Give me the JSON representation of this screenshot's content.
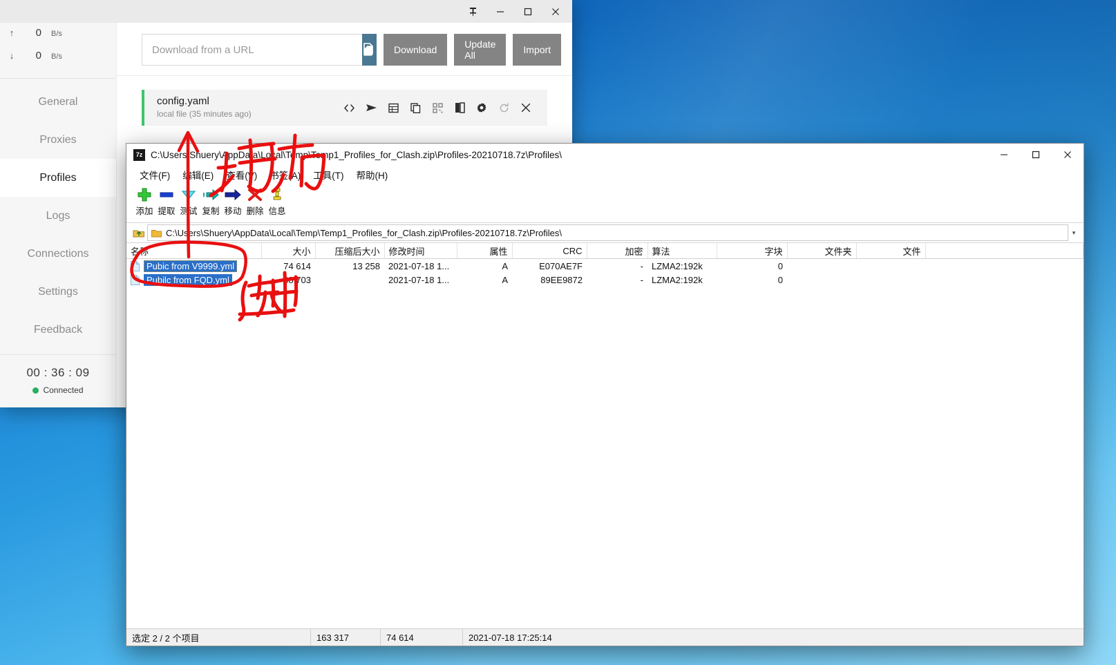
{
  "clash": {
    "titlebar": {
      "pin": "pin-icon",
      "minimize": "–",
      "maximize": "□",
      "close": "✕"
    },
    "speed": {
      "upload": {
        "arrow": "↑",
        "value": "0",
        "unit": "B/s"
      },
      "download": {
        "arrow": "↓",
        "value": "0",
        "unit": "B/s"
      }
    },
    "nav": [
      {
        "label": "General",
        "active": false
      },
      {
        "label": "Proxies",
        "active": false
      },
      {
        "label": "Profiles",
        "active": true
      },
      {
        "label": "Logs",
        "active": false
      },
      {
        "label": "Connections",
        "active": false
      },
      {
        "label": "Settings",
        "active": false
      },
      {
        "label": "Feedback",
        "active": false
      }
    ],
    "footer": {
      "clock": "00 : 36 : 09",
      "status": "Connected",
      "status_color": "#27ae60"
    },
    "urlbar": {
      "placeholder": "Download from a URL",
      "value": "",
      "paste_icon": "paste-icon",
      "download_label": "Download",
      "update_all_label": "Update All",
      "import_label": "Import"
    },
    "profile": {
      "name": "config.yaml",
      "subtitle": "local file (35 minutes ago)",
      "accent": "#3ec46d",
      "icons": [
        "code-icon",
        "send-icon",
        "table-icon",
        "copy-icon",
        "qrcode-icon",
        "split-icon",
        "gear-icon",
        "refresh-icon",
        "close-icon"
      ]
    }
  },
  "sevenzip": {
    "title": "C:\\Users\\Shuery\\AppData\\Local\\Temp\\Temp1_Profiles_for_Clash.zip\\Profiles-20210718.7z\\Profiles\\",
    "app_icon": "7z",
    "window_buttons": {
      "minimize": "–",
      "maximize": "□",
      "close": "✕"
    },
    "menu": [
      "文件(F)",
      "编辑(E)",
      "查看(V)",
      "书签(A)",
      "工具(T)",
      "帮助(H)"
    ],
    "toolbar": [
      {
        "label": "添加",
        "icon": "add-icon"
      },
      {
        "label": "提取",
        "icon": "extract-icon"
      },
      {
        "label": "测试",
        "icon": "test-icon"
      },
      {
        "label": "复制",
        "icon": "copy-icon"
      },
      {
        "label": "移动",
        "icon": "move-icon"
      },
      {
        "label": "删除",
        "icon": "delete-icon"
      },
      {
        "label": "信息",
        "icon": "info-icon"
      }
    ],
    "address": {
      "up_icon": "up-folder-icon",
      "folder_icon": "folder-icon",
      "path": "C:\\Users\\Shuery\\AppData\\Local\\Temp\\Temp1_Profiles_for_Clash.zip\\Profiles-20210718.7z\\Profiles\\",
      "caret": "chevron-down-icon"
    },
    "columns": [
      "名称",
      "大小",
      "压缩后大小",
      "修改时间",
      "属性",
      "CRC",
      "加密",
      "算法",
      "字块",
      "文件夹",
      "文件"
    ],
    "rows": [
      {
        "name": "Pubic from V9999.yml",
        "size": "74 614",
        "packed": "13 258",
        "modified": "2021-07-18 1...",
        "attributes": "A",
        "crc": "E070AE7F",
        "encrypted": "-",
        "method": "LZMA2:192k",
        "block": "0",
        "folders": "",
        "files": "",
        "selected": true,
        "focused": true
      },
      {
        "name": "Pubilc from FQD.yml",
        "size": "88 703",
        "packed": "",
        "modified": "2021-07-18 1...",
        "attributes": "A",
        "crc": "89EE9872",
        "encrypted": "-",
        "method": "LZMA2:192k",
        "block": "0",
        "folders": "",
        "files": "",
        "selected": true,
        "focused": false
      }
    ],
    "status": {
      "selection": "选定 2 / 2 个项目",
      "total_size": "163 317",
      "packed_size": "74 614",
      "timestamp": "2021-07-18 17:25:14"
    }
  },
  "annotations": {
    "color": "#e81010",
    "drag_label": "拖动",
    "select_label": "选中"
  }
}
